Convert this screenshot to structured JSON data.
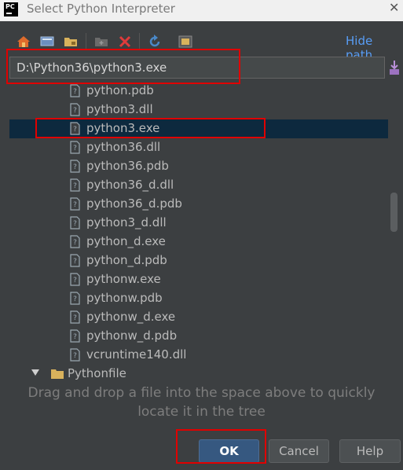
{
  "window": {
    "title": "Select Python Interpreter",
    "app_icon_text": "PC"
  },
  "toolbar": {
    "icons": [
      "home-icon",
      "desktop-icon",
      "folder-icon",
      "new-folder-icon",
      "delete-icon",
      "refresh-icon",
      "show-hidden-icon"
    ],
    "hide_path_label": "Hide path"
  },
  "path": {
    "value": "D:\\Python36\\python3.exe"
  },
  "tree": {
    "files": [
      {
        "label": "python.pdb",
        "selected": false
      },
      {
        "label": "python3.dll",
        "selected": false
      },
      {
        "label": "python3.exe",
        "selected": true
      },
      {
        "label": "python36.dll",
        "selected": false
      },
      {
        "label": "python36.pdb",
        "selected": false
      },
      {
        "label": "python36_d.dll",
        "selected": false
      },
      {
        "label": "python36_d.pdb",
        "selected": false
      },
      {
        "label": "python3_d.dll",
        "selected": false
      },
      {
        "label": "python_d.exe",
        "selected": false
      },
      {
        "label": "python_d.pdb",
        "selected": false
      },
      {
        "label": "pythonw.exe",
        "selected": false
      },
      {
        "label": "pythonw.pdb",
        "selected": false
      },
      {
        "label": "pythonw_d.exe",
        "selected": false
      },
      {
        "label": "pythonw_d.pdb",
        "selected": false
      },
      {
        "label": "vcruntime140.dll",
        "selected": false
      }
    ],
    "folder": {
      "label": "Pythonfile",
      "expanded": true
    }
  },
  "hint": {
    "line1": "Drag and drop a file into the space above to quickly",
    "line2": "locate it in the tree"
  },
  "buttons": {
    "ok": "OK",
    "cancel": "Cancel",
    "help": "Help"
  },
  "colors": {
    "background": "#3c3f41",
    "selection": "#0d293e",
    "link": "#589df6",
    "highlight_box": "#e00000",
    "ok_button": "#365880"
  }
}
